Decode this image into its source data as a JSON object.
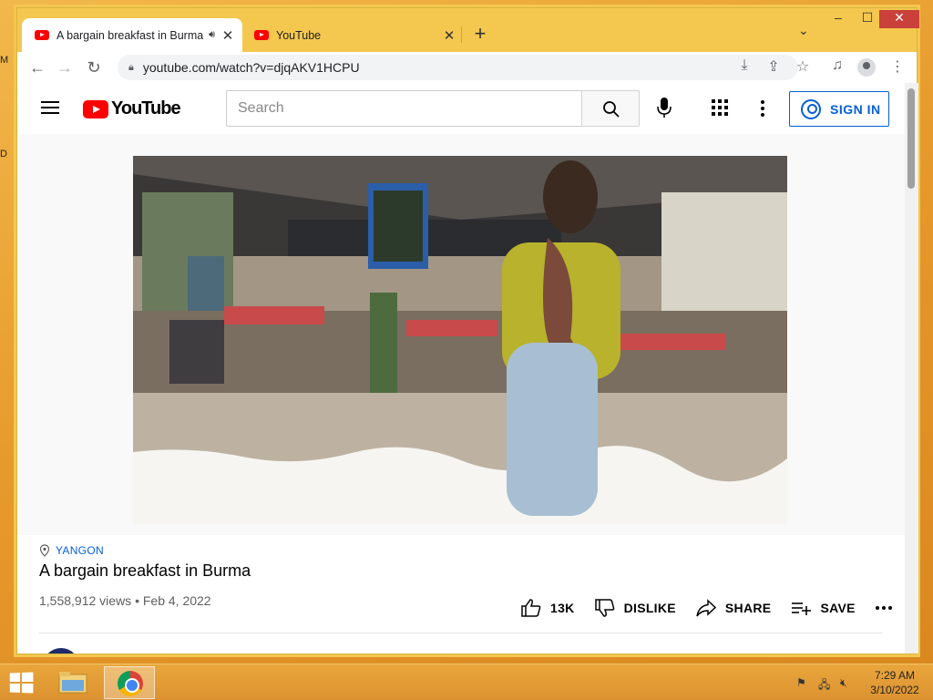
{
  "desktop": {
    "side_letters": [
      "M",
      "D"
    ]
  },
  "browser": {
    "tabs": [
      {
        "title": "A bargain breakfast in Burma",
        "active": true,
        "audio": true
      },
      {
        "title": "YouTube",
        "active": false,
        "audio": false
      }
    ],
    "url": "youtube.com/watch?v=djqAKV1HCPU",
    "icons": [
      "back-icon",
      "forward-icon",
      "reload-icon",
      "lock-icon",
      "install-icon",
      "share-icon",
      "star-icon",
      "media-icon",
      "profile-icon",
      "menu-icon"
    ]
  },
  "youtube": {
    "logo_text": "YouTube",
    "search_placeholder": "Search",
    "sign_in_label": "SIGN IN",
    "video": {
      "location": "YANGON",
      "title": "A bargain breakfast in Burma",
      "views_date": "1,558,912 views • Feb 4, 2022",
      "likes": "13K",
      "dislike_label": "DISLIKE",
      "share_label": "SHARE",
      "save_label": "SAVE"
    }
  },
  "taskbar": {
    "time": "7:29 AM",
    "date": "3/10/2022"
  },
  "colors": {
    "accent_blue": "#065fd4",
    "youtube_red": "#ff0000",
    "taskbar_orange": "#e09a34"
  }
}
